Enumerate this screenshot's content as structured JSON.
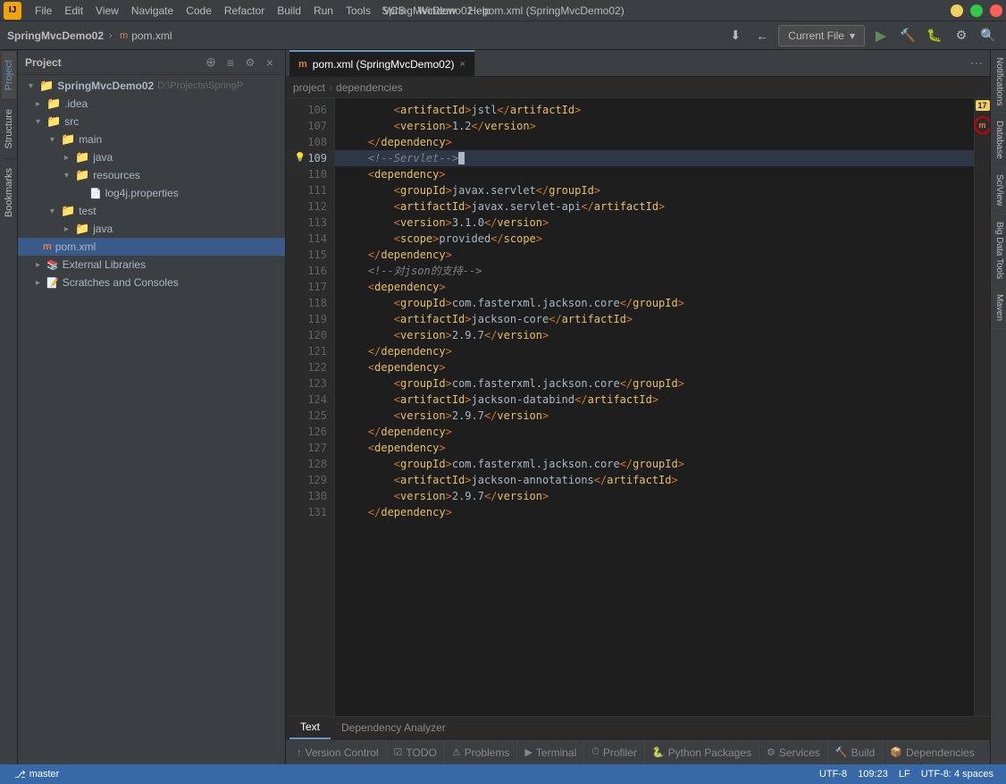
{
  "app": {
    "logo": "IJ",
    "title": "SpringMvcDemo02 - pom.xml (SpringMvcDemo02)",
    "project_name": "SpringMvcDemo02",
    "file_name": "pom.xml"
  },
  "menu": {
    "items": [
      "File",
      "Edit",
      "View",
      "Navigate",
      "Code",
      "Refactor",
      "Build",
      "Run",
      "Tools",
      "VCS",
      "Window",
      "Help"
    ]
  },
  "toolbar": {
    "project_label": "Project",
    "breadcrumb": [
      "SpringMvcDemo02",
      "pom.xml"
    ],
    "current_file_label": "Current File",
    "dropdown_arrow": "▾"
  },
  "tabs": {
    "editor_tabs": [
      {
        "icon": "m",
        "label": "pom.xml (SpringMvcDemo02)",
        "active": true
      }
    ],
    "tab_menu_icon": "⋯"
  },
  "breadcrumb": {
    "items": [
      "project",
      "dependencies"
    ]
  },
  "sidebar": {
    "title": "Project",
    "tree": [
      {
        "level": 0,
        "type": "project",
        "label": "SpringMvcDemo02",
        "extra": "D:\\Projects\\SpringP",
        "expanded": true
      },
      {
        "level": 1,
        "type": "folder",
        "label": ".idea",
        "expanded": false
      },
      {
        "level": 1,
        "type": "folder",
        "label": "src",
        "expanded": true
      },
      {
        "level": 2,
        "type": "folder",
        "label": "main",
        "expanded": true
      },
      {
        "level": 3,
        "type": "folder",
        "label": "java",
        "expanded": false
      },
      {
        "level": 3,
        "type": "folder",
        "label": "resources",
        "expanded": true
      },
      {
        "level": 4,
        "type": "properties",
        "label": "log4j.properties"
      },
      {
        "level": 2,
        "type": "folder",
        "label": "test",
        "expanded": true
      },
      {
        "level": 3,
        "type": "folder",
        "label": "java",
        "expanded": false
      },
      {
        "level": 0,
        "type": "xml",
        "label": "pom.xml",
        "selected": true
      },
      {
        "level": 0,
        "type": "folder",
        "label": "External Libraries",
        "expanded": false
      },
      {
        "level": 0,
        "type": "folder",
        "label": "Scratches and Consoles",
        "expanded": false
      }
    ]
  },
  "editor": {
    "lines": [
      {
        "num": 106,
        "content": "        <artifactId>jstl</artifactId>",
        "type": "normal"
      },
      {
        "num": 107,
        "content": "        <version>1.2</version>",
        "type": "normal"
      },
      {
        "num": 108,
        "content": "    </dependency>",
        "type": "normal"
      },
      {
        "num": 109,
        "content": "    <!--Servlet-->",
        "type": "comment",
        "cursor": true,
        "lamp": true
      },
      {
        "num": 110,
        "content": "    <dependency>",
        "type": "normal"
      },
      {
        "num": 111,
        "content": "        <groupId>javax.servlet</groupId>",
        "type": "normal"
      },
      {
        "num": 112,
        "content": "        <artifactId>javax.servlet-api</artifactId>",
        "type": "normal"
      },
      {
        "num": 113,
        "content": "        <version>3.1.0</version>",
        "type": "normal"
      },
      {
        "num": 114,
        "content": "        <scope>provided</scope>",
        "type": "normal"
      },
      {
        "num": 115,
        "content": "    </dependency>",
        "type": "normal"
      },
      {
        "num": 116,
        "content": "    <!--对json的支持-->",
        "type": "comment"
      },
      {
        "num": 117,
        "content": "    <dependency>",
        "type": "normal"
      },
      {
        "num": 118,
        "content": "        <groupId>com.fasterxml.jackson.core</groupId>",
        "type": "normal"
      },
      {
        "num": 119,
        "content": "        <artifactId>jackson-core</artifactId>",
        "type": "normal"
      },
      {
        "num": 120,
        "content": "        <version>2.9.7</version>",
        "type": "normal"
      },
      {
        "num": 121,
        "content": "    </dependency>",
        "type": "normal"
      },
      {
        "num": 122,
        "content": "    <dependency>",
        "type": "normal"
      },
      {
        "num": 123,
        "content": "        <groupId>com.fasterxml.jackson.core</groupId>",
        "type": "normal"
      },
      {
        "num": 124,
        "content": "        <artifactId>jackson-databind</artifactId>",
        "type": "normal"
      },
      {
        "num": 125,
        "content": "        <version>2.9.7</version>",
        "type": "normal"
      },
      {
        "num": 126,
        "content": "    </dependency>",
        "type": "normal"
      },
      {
        "num": 127,
        "content": "    <dependency>",
        "type": "normal"
      },
      {
        "num": 128,
        "content": "        <groupId>com.fasterxml.jackson.core</groupId>",
        "type": "normal"
      },
      {
        "num": 129,
        "content": "        <artifactId>jackson-annotations</artifactId>",
        "type": "normal"
      },
      {
        "num": 130,
        "content": "        <version>2.9.7</version>",
        "type": "normal"
      },
      {
        "num": 131,
        "content": "    </dependency>",
        "type": "normal"
      }
    ],
    "warning_count": "17"
  },
  "bottom_tabs": [
    {
      "icon": "↑",
      "label": "Version Control",
      "active": false
    },
    {
      "icon": "☑",
      "label": "TODO",
      "active": false
    },
    {
      "icon": "⚠",
      "label": "Problems",
      "active": false
    },
    {
      "icon": ">_",
      "label": "Terminal",
      "active": false
    },
    {
      "icon": "⏱",
      "label": "Profiler",
      "active": false
    },
    {
      "icon": "🐍",
      "label": "Python Packages",
      "active": false
    },
    {
      "icon": "⚙",
      "label": "Services",
      "active": false
    },
    {
      "icon": "🔨",
      "label": "Build",
      "active": false
    },
    {
      "icon": "📦",
      "label": "Dependencies",
      "active": false
    }
  ],
  "bottom_editor_tabs": [
    {
      "label": "Text",
      "active": true
    },
    {
      "label": "Dependency Analyzer",
      "active": false
    }
  ],
  "status_bar": {
    "encoding": "UTF-8",
    "position": "109:23",
    "line_sep": "LF",
    "indent": "UTF-8: 4 spaces"
  },
  "right_panels": [
    "Notifications",
    "Database",
    "SciView",
    "Big Data Tools",
    "Maven"
  ],
  "left_panels": [
    "Project",
    "Structure",
    "Bookmarks"
  ]
}
